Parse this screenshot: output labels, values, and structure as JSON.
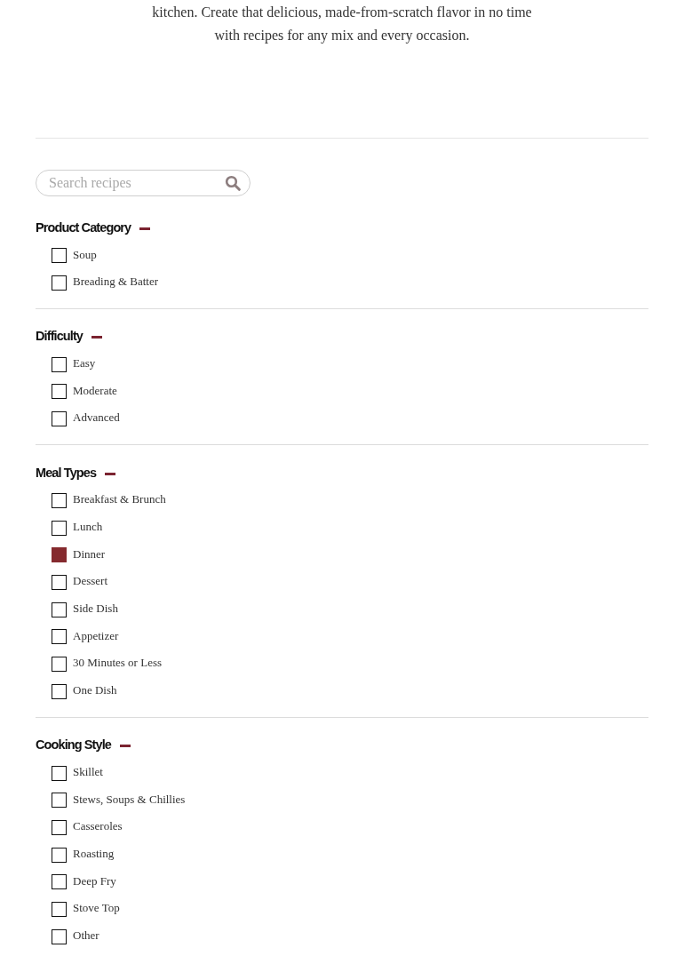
{
  "intro": {
    "lines": [
      "kitchen. Create that delicious, made-from-scratch flavor in no time",
      "with recipes for any mix and every occasion."
    ]
  },
  "search": {
    "placeholder": "Search recipes"
  },
  "filters": [
    {
      "title": "Product Category",
      "expanded": true,
      "options": [
        {
          "label": "Soup",
          "checked": false
        },
        {
          "label": "Breading & Batter",
          "checked": false
        }
      ]
    },
    {
      "title": "Difficulty",
      "expanded": true,
      "options": [
        {
          "label": "Easy",
          "checked": false
        },
        {
          "label": "Moderate",
          "checked": false
        },
        {
          "label": "Advanced",
          "checked": false
        }
      ]
    },
    {
      "title": "Meal Types",
      "expanded": true,
      "options": [
        {
          "label": "Breakfast & Brunch",
          "checked": false
        },
        {
          "label": "Lunch",
          "checked": false
        },
        {
          "label": "Dinner",
          "checked": true
        },
        {
          "label": "Dessert",
          "checked": false
        },
        {
          "label": "Side Dish",
          "checked": false
        },
        {
          "label": "Appetizer",
          "checked": false
        },
        {
          "label": "30 Minutes or Less",
          "checked": false
        },
        {
          "label": "One Dish",
          "checked": false
        }
      ]
    },
    {
      "title": "Cooking Style",
      "expanded": true,
      "options": [
        {
          "label": "Skillet",
          "checked": false
        },
        {
          "label": "Stews, Soups & Chillies",
          "checked": false
        },
        {
          "label": "Casseroles",
          "checked": false
        },
        {
          "label": "Roasting",
          "checked": false
        },
        {
          "label": "Deep Fry",
          "checked": false
        },
        {
          "label": "Stove Top",
          "checked": false
        },
        {
          "label": "Other",
          "checked": false
        }
      ]
    }
  ]
}
